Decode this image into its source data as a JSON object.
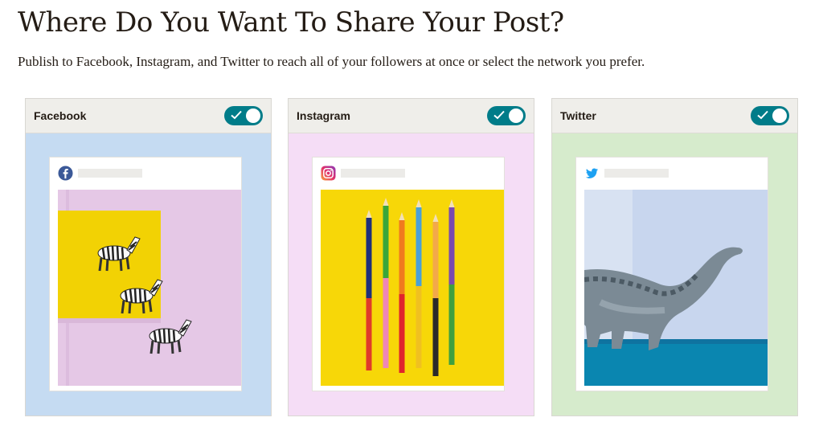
{
  "page": {
    "title": "Where Do You Want To Share Your Post?",
    "subtitle": "Publish to Facebook, Instagram, and Twitter to reach all of your followers at once or select the network you prefer."
  },
  "colors": {
    "toggle_on": "#007c89",
    "header_bg": "#efeeea",
    "facebook_bg": "#c5dbf2",
    "instagram_bg": "#f5ddf6",
    "twitter_bg": "#d6ebcc"
  },
  "networks": [
    {
      "name": "Facebook",
      "enabled": true,
      "icon": "facebook-icon",
      "image": "zebra-figurines-photo"
    },
    {
      "name": "Instagram",
      "enabled": true,
      "icon": "instagram-icon",
      "image": "colored-pencils-photo"
    },
    {
      "name": "Twitter",
      "enabled": true,
      "icon": "twitter-icon",
      "image": "toy-dinosaur-photo"
    }
  ]
}
